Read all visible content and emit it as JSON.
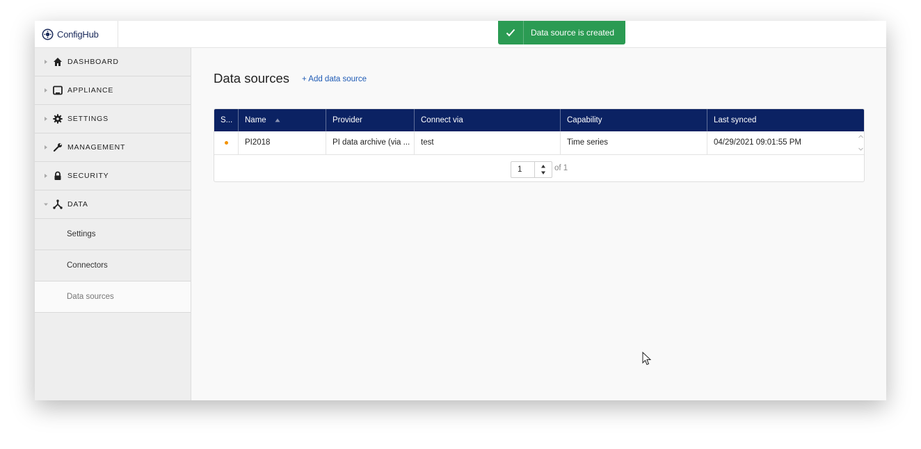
{
  "app": {
    "name": "ConfigHub"
  },
  "toast": {
    "text": "Data source is created",
    "color": "#2b9b53"
  },
  "sidebar": {
    "items": [
      {
        "label": "DASHBOARD",
        "icon": "home-icon"
      },
      {
        "label": "APPLIANCE",
        "icon": "appliance-icon"
      },
      {
        "label": "SETTINGS",
        "icon": "gear-icon"
      },
      {
        "label": "MANAGEMENT",
        "icon": "wrench-icon"
      },
      {
        "label": "SECURITY",
        "icon": "lock-icon"
      },
      {
        "label": "DATA",
        "icon": "network-icon",
        "expanded": true
      }
    ],
    "sub_items": [
      {
        "label": "Settings"
      },
      {
        "label": "Connectors"
      },
      {
        "label": "Data sources",
        "active": true
      }
    ]
  },
  "main": {
    "title": "Data sources",
    "add_link": "+ Add data source",
    "table": {
      "header_color": "#0b2263",
      "columns": [
        "S...",
        "Name",
        "Provider",
        "Connect via",
        "Capability",
        "Last synced"
      ],
      "sort_column": "Name",
      "rows": [
        {
          "status_color": "#f39200",
          "name": "PI2018",
          "provider": "PI data archive (via ...",
          "connect_via": "test",
          "capability": "Time series",
          "last_synced": "04/29/2021 09:01:55 PM"
        }
      ]
    },
    "pager": {
      "page": "1",
      "of_text": "of 1"
    }
  }
}
